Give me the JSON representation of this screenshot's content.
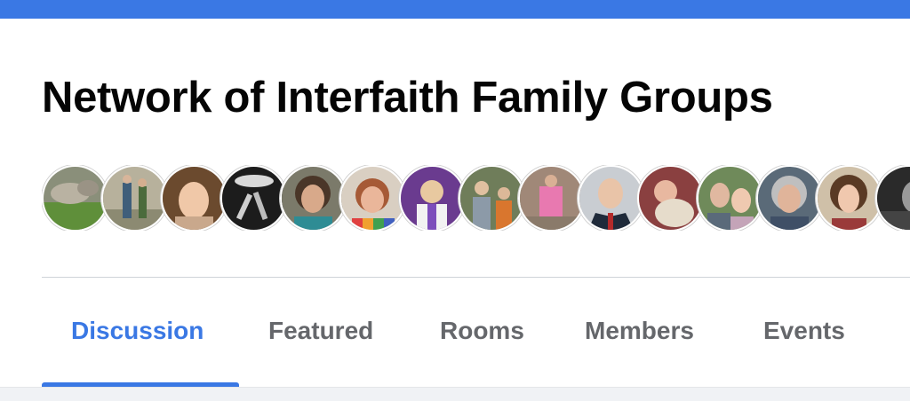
{
  "header": {
    "title": "Network of Interfaith Family Groups"
  },
  "members": {
    "avatars": [
      {
        "icon": "member-avatar"
      },
      {
        "icon": "member-avatar"
      },
      {
        "icon": "member-avatar"
      },
      {
        "icon": "member-avatar"
      },
      {
        "icon": "member-avatar"
      },
      {
        "icon": "member-avatar"
      },
      {
        "icon": "member-avatar"
      },
      {
        "icon": "member-avatar"
      },
      {
        "icon": "member-avatar"
      },
      {
        "icon": "member-avatar"
      },
      {
        "icon": "member-avatar"
      },
      {
        "icon": "member-avatar"
      },
      {
        "icon": "member-avatar"
      },
      {
        "icon": "member-avatar"
      },
      {
        "icon": "member-avatar"
      }
    ]
  },
  "tabs": [
    {
      "label": "Discussion",
      "active": true
    },
    {
      "label": "Featured",
      "active": false
    },
    {
      "label": "Rooms",
      "active": false
    },
    {
      "label": "Members",
      "active": false
    },
    {
      "label": "Events",
      "active": false
    }
  ],
  "colors": {
    "accent": "#3a78e4",
    "tab_inactive": "#65676b",
    "title": "#050505"
  }
}
